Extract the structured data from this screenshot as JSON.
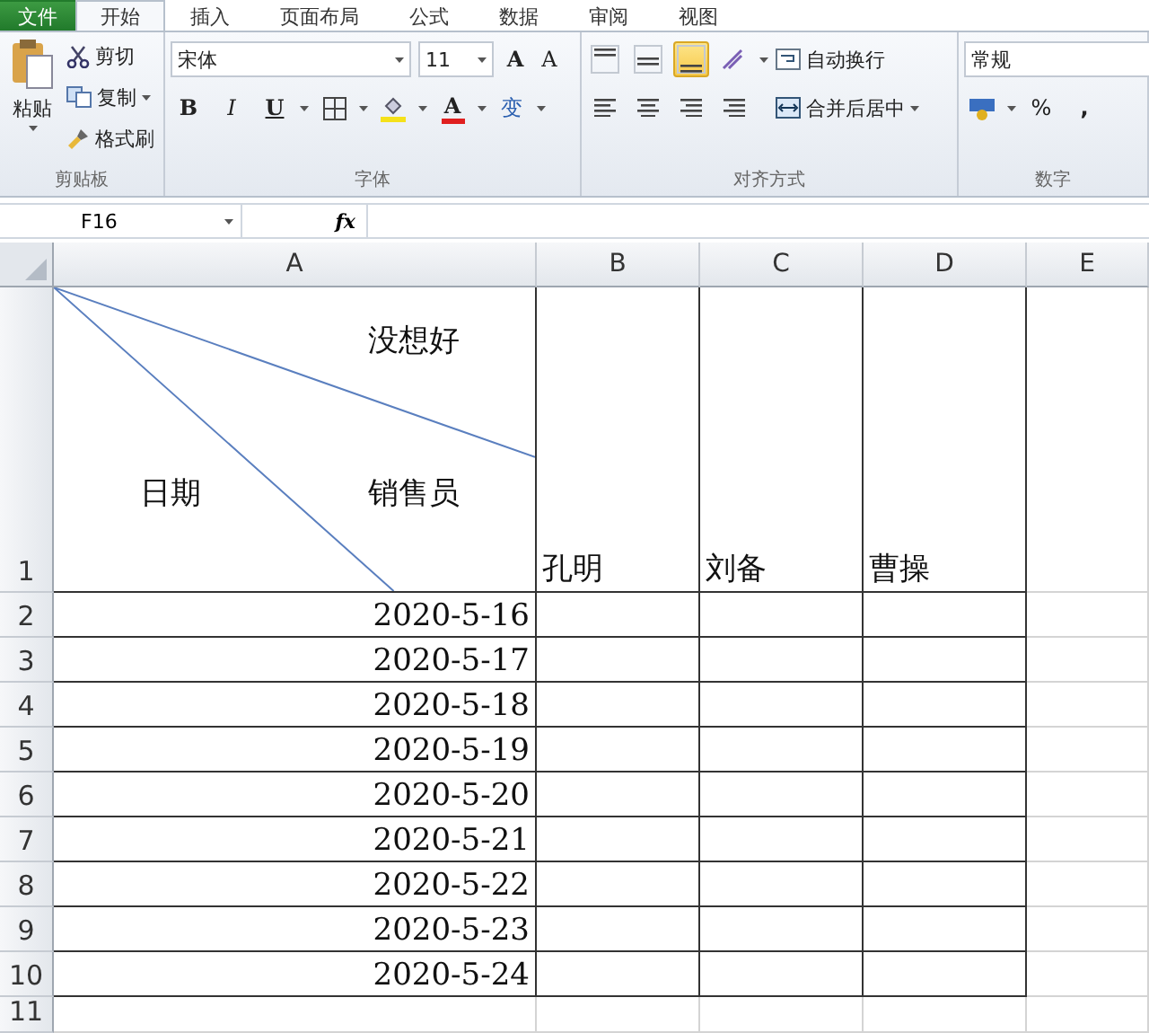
{
  "tabs": [
    {
      "label": "文件",
      "kind": "file",
      "selected": false
    },
    {
      "label": "开始",
      "kind": "tab",
      "selected": true
    },
    {
      "label": "插入",
      "kind": "tab",
      "selected": false
    },
    {
      "label": "页面布局",
      "kind": "tab",
      "selected": false
    },
    {
      "label": "公式",
      "kind": "tab",
      "selected": false
    },
    {
      "label": "数据",
      "kind": "tab",
      "selected": false
    },
    {
      "label": "审阅",
      "kind": "tab",
      "selected": false
    },
    {
      "label": "视图",
      "kind": "tab",
      "selected": false
    }
  ],
  "ribbon": {
    "clipboard": {
      "paste": "粘贴",
      "cut": "剪切",
      "copy": "复制",
      "format_painter": "格式刷",
      "label": "剪贴板"
    },
    "font": {
      "name": "宋体",
      "size": "11",
      "grow": "A",
      "shrink": "A",
      "bold": "B",
      "italic": "I",
      "underline": "U",
      "font_color": "A",
      "phonetic": "变",
      "label": "字体"
    },
    "alignment": {
      "vertical": [
        {
          "kind": "top",
          "selected": false
        },
        {
          "kind": "middle",
          "selected": false
        },
        {
          "kind": "bottom",
          "selected": true
        }
      ],
      "horizontal": [
        {
          "kind": "left",
          "selected": false
        },
        {
          "kind": "center",
          "selected": false
        },
        {
          "kind": "right",
          "selected": false
        }
      ],
      "wrap": "自动换行",
      "merge": "合并后居中",
      "label": "对齐方式"
    },
    "number": {
      "format": "常规",
      "percent": "%",
      "comma": ",",
      "label": "数字"
    }
  },
  "formula_bar": {
    "name_box": "F16",
    "fx": "fx"
  },
  "sheet": {
    "columns": [
      "A",
      "B",
      "C",
      "D",
      "E"
    ],
    "header_cell": {
      "top": "没想好",
      "left": "日期",
      "right": "销售员"
    },
    "row_1": {
      "number": "1",
      "names": [
        "孔明",
        "刘备",
        "曹操"
      ]
    },
    "rows": [
      {
        "number": "2",
        "date": "2020-5-16"
      },
      {
        "number": "3",
        "date": "2020-5-17"
      },
      {
        "number": "4",
        "date": "2020-5-18"
      },
      {
        "number": "5",
        "date": "2020-5-19"
      },
      {
        "number": "6",
        "date": "2020-5-20"
      },
      {
        "number": "7",
        "date": "2020-5-21"
      },
      {
        "number": "8",
        "date": "2020-5-22"
      },
      {
        "number": "9",
        "date": "2020-5-23"
      },
      {
        "number": "10",
        "date": "2020-5-24"
      },
      {
        "number": "11"
      }
    ]
  }
}
